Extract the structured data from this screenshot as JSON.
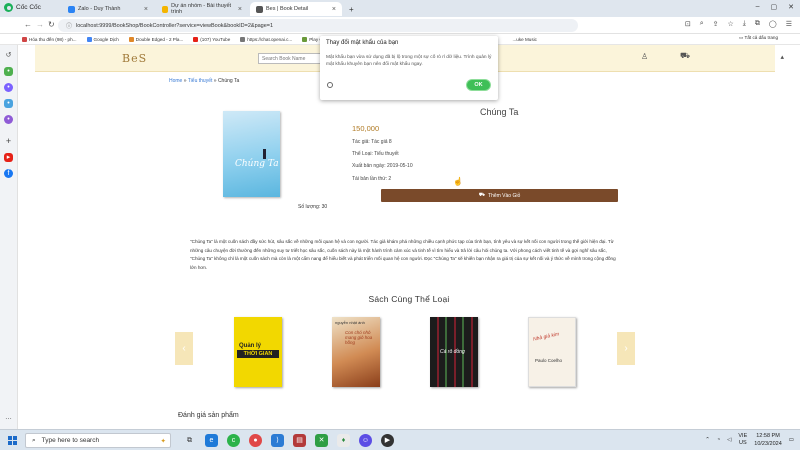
{
  "browser": {
    "brand": "Cốc Cốc",
    "tabs": [
      {
        "label": "Zalo - Duy Thành"
      },
      {
        "label": "Dự án nhóm - Bài thuyết trình"
      },
      {
        "label": "Bes | Book Detail"
      }
    ],
    "new_tab": "+",
    "url": "localhost:9999/BookShop/BookController?service=viewBook&bookID=2&page=1",
    "bookmarks": [
      "Hóa thu đến (98) - ph...",
      "Google Dịch",
      "Double Edged - 2 Pla...",
      "(107) YouTube",
      "https://chat.openai.c...",
      "Play Chess",
      "...uke Music"
    ],
    "all_bookmarks": "Tất cả dấu trang"
  },
  "site": {
    "logo": "BeS",
    "search_placeholder": "Search Book Name",
    "breadcrumb": {
      "home": "Home",
      "sep1": " » ",
      "category": "Tiểu thuyết",
      "sep2": " » ",
      "current": "Chúng Ta"
    }
  },
  "book": {
    "cover_text": "Chúng Ta",
    "title": "Chúng Ta",
    "price": "150,000",
    "author": "Tác giả: Tác giả 8",
    "category": "Thể Loại: Tiểu thuyết",
    "published": "Xuất bản ngày: 2019-05-10",
    "edition": "Tái bản lần thứ: 2",
    "add_to_cart": "Thêm Vào Giỏ",
    "stock": "Số lượng: 30",
    "description": "\"Chúng Ta\" là một cuốn sách đầy sức hút, sâu sắc về những mối quan hệ và con người. Tác giả khám phá những chiều cạnh phức tạp của tình bạn, tình yêu và sự kết nối con người trong thế giới hiện đại. Từ những câu chuyện đời thường đến những suy tư triết học sâu sắc, cuốn sách này là một hành trình cảm xúc và tinh tế vì tìm hiểu và trả lời câu hỏi chúng ta. Với phong cách viết tinh tế và gợi nghĩ sâu sắc, \"Chúng Ta\" không chỉ là một cuốn sách mà còn là một cẩm nang để hiểu biết và phát triển mối quan hệ con người. Đọc \"Chúng Ta\" sẽ khiến bạn nhận ra giá trị của sự kết nối và ý thức về mình trong cộng đồng lớn hơn."
  },
  "related": {
    "title": "Sách Cùng Thể Loại",
    "prev": "‹",
    "next": "›",
    "books": [
      {
        "line1": "Quản lý",
        "line2": "THỜI GIAN"
      },
      {
        "line1": "nguyễn nhật ánh",
        "line2": "Con chó nhỏ mang giỏ hoa hồng"
      },
      {
        "line1": "Cá rô đồng"
      },
      {
        "line1": "Nhà giả kim",
        "line2": "Paulo Coelho"
      }
    ]
  },
  "reviews": {
    "title": "Đánh giá sản phẩm"
  },
  "modal": {
    "title": "Thay đổi mật khẩu của bạn",
    "text": "Mật khẩu bạn vừa sử dụng đã bị lộ trong một sự cố rò rỉ dữ liệu. Trình quản lý mật khẩu khuyên bạn nên đổi mật khẩu ngay.",
    "ok": "OK"
  },
  "taskbar": {
    "search_placeholder": "Type here to search",
    "lang_line1": "VIE",
    "lang_line2": "US",
    "time": "12:58 PM",
    "date": "10/23/2024"
  }
}
